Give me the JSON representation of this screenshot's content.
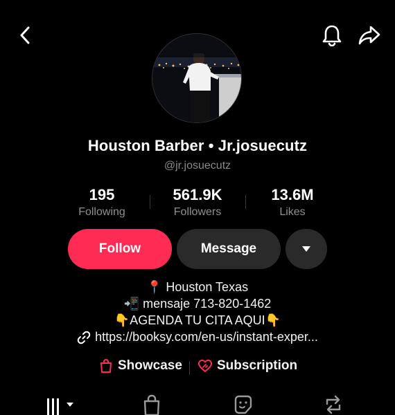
{
  "header": {
    "back_icon": "chevron-left-icon",
    "notification_icon": "bell-icon",
    "share_icon": "share-arrow-icon"
  },
  "profile": {
    "display_name": "Houston Barber • Jr.josuecutz",
    "handle": "@jr.josuecutz"
  },
  "stats": [
    {
      "value": "195",
      "label": "Following"
    },
    {
      "value": "561.9K",
      "label": "Followers"
    },
    {
      "value": "13.6M",
      "label": "Likes"
    }
  ],
  "actions": {
    "follow_label": "Follow",
    "message_label": "Message",
    "more_icon": "caret-down-icon"
  },
  "bio": {
    "line1": "📍 Houston Texas",
    "line2": "📲 mensaje 713-820-1462",
    "line3": "👇AGENDA TU CITA AQUI👇",
    "link": "https://booksy.com/en-us/instant-exper..."
  },
  "links": {
    "showcase_label": "Showcase",
    "subscription_label": "Subscription"
  },
  "tabs": [
    "videos-grid-icon",
    "bag-icon",
    "sticker-icon",
    "repost-icon"
  ],
  "colors": {
    "accent": "#fe2c55",
    "background": "#000000",
    "secondary_button": "#2a2a2a",
    "muted_text": "#8f8f8f"
  }
}
